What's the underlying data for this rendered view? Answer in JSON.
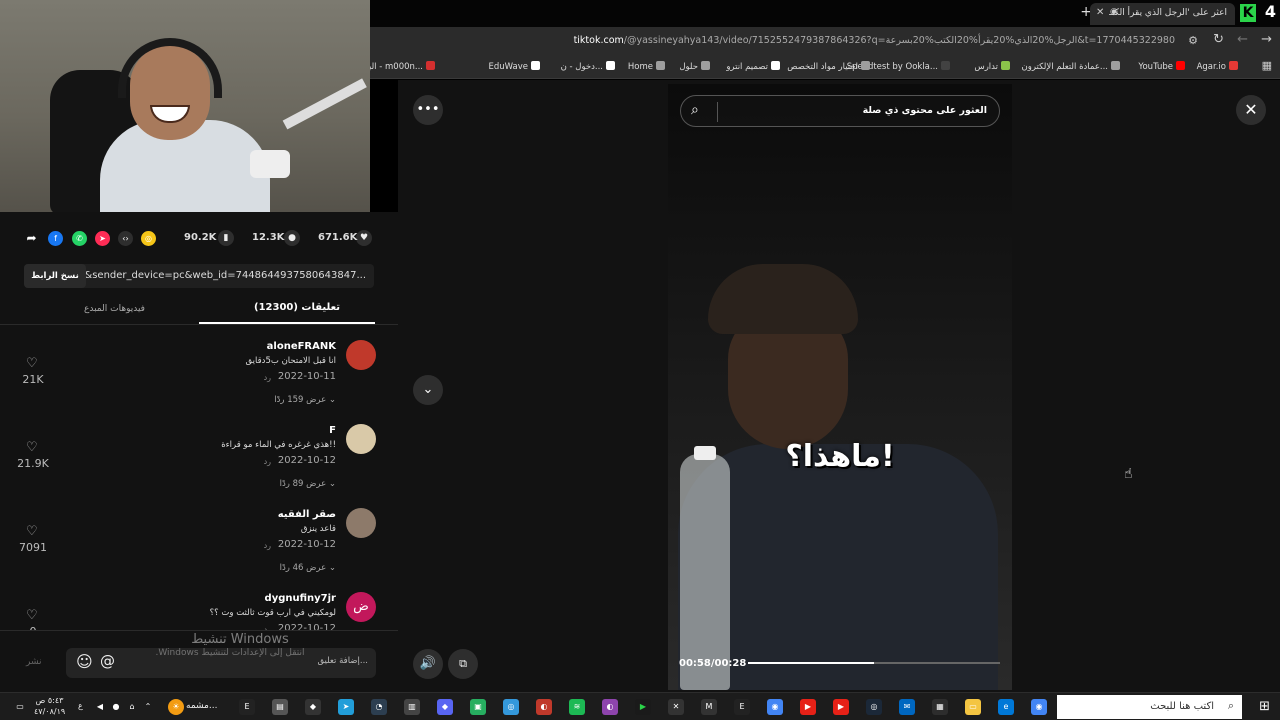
{
  "browser": {
    "tab_title": "اعثر على 'الرجل الذي يقرأ الكتـ",
    "url_host": "tiktok.com",
    "url_path": "/@yassineyahya143/video/7152552479387864326?q=الرجل%20الذي%20يقرأ%20الكتب%20بسرعة&t=1770445322980",
    "logo_letter": "K",
    "tab_count": "4"
  },
  "bookmarks": [
    {
      "label": "Agar.io",
      "color": "#e53935"
    },
    {
      "label": "YouTube",
      "color": "#ff0000"
    },
    {
      "label": "عمادة التعلم الإلكترون...",
      "color": "#9e9e9e"
    },
    {
      "label": "تدارس",
      "color": "#8bc34a"
    },
    {
      "label": "Speedtest by Ookla...",
      "color": "#424242"
    },
    {
      "label": "اختيار مواد التخصص",
      "color": "#9e9e9e"
    },
    {
      "label": "تصميم انترو",
      "color": "#ffffff"
    },
    {
      "label": "حلول",
      "color": "#9e9e9e"
    },
    {
      "label": "Home",
      "color": "#9e9e9e"
    },
    {
      "label": "دخول - ن...",
      "color": "#ffffff"
    },
    {
      "label": "EduWave",
      "color": "#ffffff"
    },
    {
      "label": "البريد الوارد - m000n...",
      "color": "#d32f2f"
    }
  ],
  "stats": {
    "likes": "671.6K",
    "comments": "12.3K",
    "saves": "90.2K"
  },
  "share_link": {
    "text": "=1&sender_device=pc&web_id=7448644937580643847...",
    "copy_label": "نسخ الرابط"
  },
  "panel_tabs": {
    "comments": "تعليقات (12300)",
    "creator_videos": "فيديوهات المبدع"
  },
  "comments": [
    {
      "user": "aloneFRANK",
      "text": "انا قبل الامتحان ب5دقايق",
      "date": "2022-10-11",
      "reply": "رد",
      "more": "عرض 159 ردًا",
      "likes": "21K",
      "avatar_color": "#c0392b"
    },
    {
      "user": "F",
      "text": "هذي غرغره في الماء مو قراءة!!",
      "date": "2022-10-12",
      "reply": "رد",
      "more": "عرض 89 ردًا",
      "likes": "21.9K",
      "avatar_color": "#d9c9a8"
    },
    {
      "user": "صقر الفقيه",
      "text": "قاعد ينزق",
      "date": "2022-10-12",
      "reply": "رد",
      "more": "عرض 46 ردًا",
      "likes": "7091",
      "avatar_color": "#8d7a6a"
    },
    {
      "user": "dygnufiny7jr",
      "text": "لومكيني في ارب قوت ثالثت وت ؟؟",
      "date": "2022-10-12",
      "reply": "رد",
      "more": "",
      "likes": "0",
      "avatar_color": "#c2185b",
      "avatar_letter": "ض"
    }
  ],
  "comment_input": {
    "placeholder": "إضافة تعليق...",
    "post_label": "نشر"
  },
  "watermark": {
    "line1": "تنشيط Windows",
    "line2": "انتقل إلى الإعدادات لتنشيط Windows."
  },
  "video": {
    "search_text": "العثور على محتوى ذي صلة",
    "subtitle": "ماهذا؟!",
    "time": "00:58/00:28",
    "progress": 0.5
  },
  "taskbar": {
    "search_placeholder": "اكتب هنا للبحث",
    "clock_time": "٥:٤٣ ص",
    "clock_date": "٤٧/٠٨/١٩",
    "lang": "ع",
    "user_label": "مشمه..."
  }
}
